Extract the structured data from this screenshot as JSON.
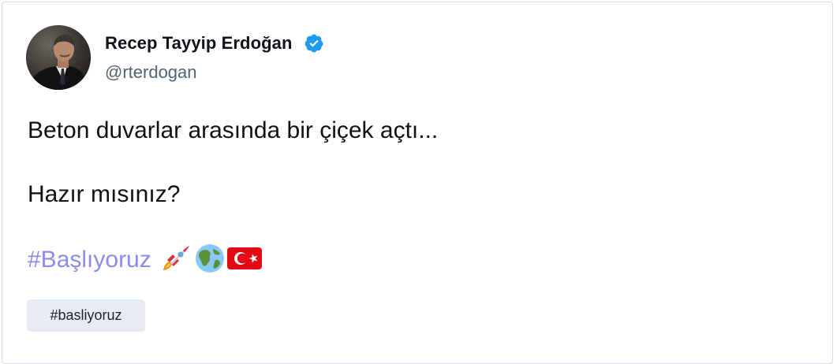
{
  "post": {
    "author": {
      "display_name": "Recep Tayyip Erdoğan",
      "handle": "@rterdogan",
      "verified": true
    },
    "lines": [
      "Beton duvarlar arasında bir çiçek açtı...",
      "Hazır mısınız?"
    ],
    "hashtag": "#Başlıyoruz",
    "emojis": [
      "rocket-icon",
      "globe-icon",
      "turkey-flag-icon"
    ],
    "chip_label": "#basliyoruz"
  },
  "colors": {
    "hashtag": "#8a8cf0",
    "verified_badge": "#1d9bf0",
    "chip_background": "#e7ebf3",
    "card_border": "#d9dde3",
    "handle": "#536471"
  }
}
